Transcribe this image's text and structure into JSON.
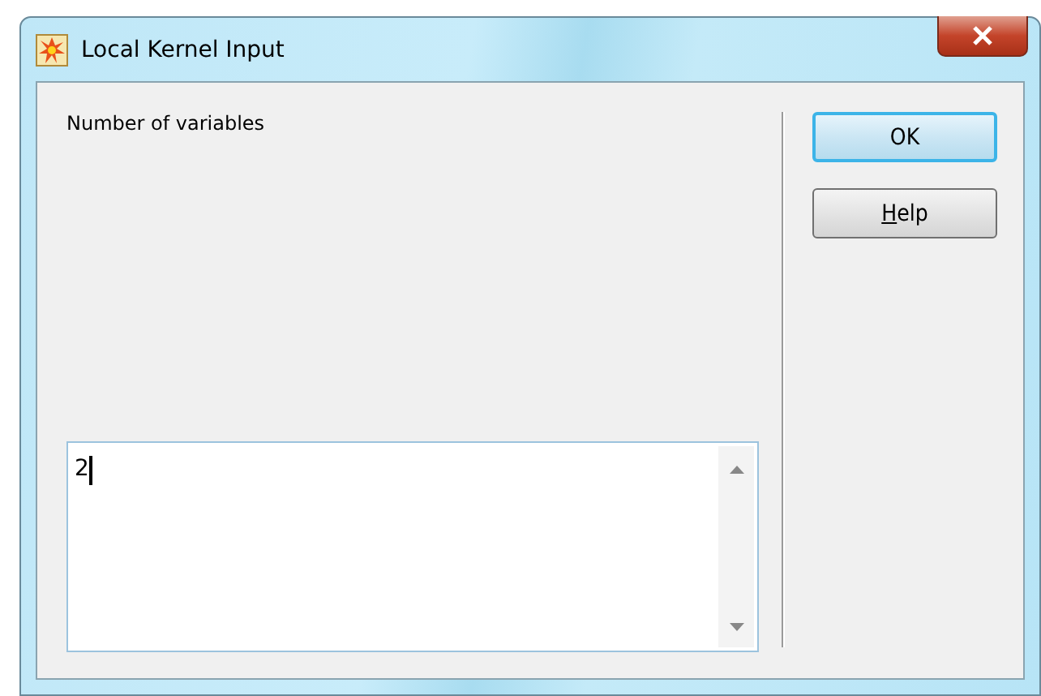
{
  "window": {
    "title": "Local Kernel Input"
  },
  "prompt": "Number of variables",
  "input": {
    "value": "2"
  },
  "buttons": [
    {
      "label": "OK",
      "default": true
    },
    {
      "label": "Help",
      "default": false
    }
  ]
}
